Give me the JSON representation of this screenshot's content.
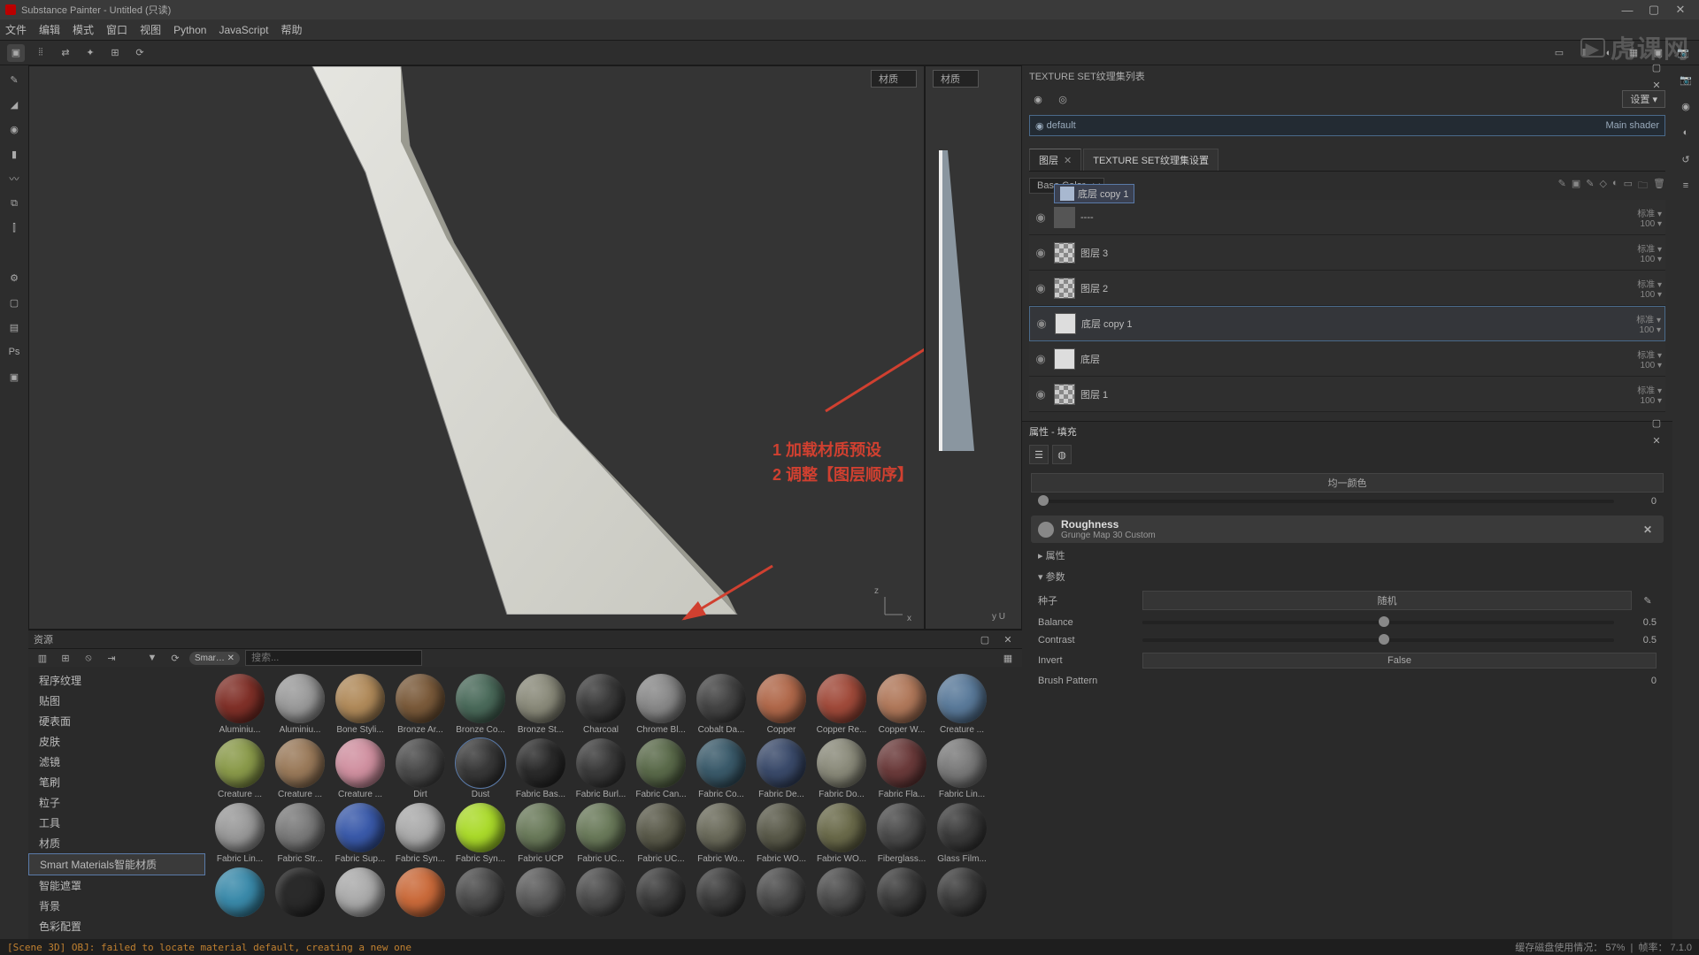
{
  "window": {
    "title": "Substance Painter - Untitled (只读)"
  },
  "menubar": [
    "文件",
    "编辑",
    "模式",
    "窗口",
    "视图",
    "Python",
    "JavaScript",
    "帮助"
  ],
  "viewport": {
    "dropdown3d": "材质",
    "dropdown2d": "材质",
    "annotation1": "1 加载材质预设",
    "annotation2": "2 调整【图层顺序】",
    "axis3d": {
      "x": "x",
      "z": "z"
    },
    "axis2d": {
      "u": "U",
      "y": "y"
    }
  },
  "right": {
    "texture_set_list_title": "TEXTURE SET纹理集列表",
    "settings_label": "设置",
    "shader_name": "default",
    "shader_type": "Main shader",
    "tab_layers": "图层",
    "tab_texset": "TEXTURE SET纹理集设置",
    "channel": "Base Color",
    "drag_ghost": "底层 copy 1",
    "layers": [
      {
        "name": "----",
        "thumb": "folder",
        "blend": "标准",
        "opacity": "100"
      },
      {
        "name": "图层 3",
        "thumb": "checker",
        "blend": "标准",
        "opacity": "100"
      },
      {
        "name": "图层 2",
        "thumb": "checker",
        "blend": "标准",
        "opacity": "100"
      },
      {
        "name": "底层 copy 1",
        "thumb": "solid",
        "blend": "标准",
        "opacity": "100",
        "selected": true
      },
      {
        "name": "底层",
        "thumb": "solid",
        "blend": "标准",
        "opacity": "100"
      },
      {
        "name": "图层 1",
        "thumb": "checker",
        "blend": "标准",
        "opacity": "100"
      }
    ],
    "props_title": "属性 - 填充",
    "fill_section": "均一颜色",
    "fill_value": "0",
    "roughness_title": "Roughness",
    "roughness_sub": "Grunge Map 30  Custom",
    "attrs_label": "属性",
    "params_label": "参数",
    "seed_label": "种子",
    "seed_btn": "随机",
    "balance_label": "Balance",
    "balance_val": "0.5",
    "contrast_label": "Contrast",
    "contrast_val": "0.5",
    "invert_label": "Invert",
    "invert_val": "False",
    "brush_label": "Brush Pattern",
    "brush_val": "0"
  },
  "assets": {
    "title": "资源",
    "search_placeholder": "搜索...",
    "filter_chip": "Smar…",
    "categories": [
      "程序纹理",
      "贴图",
      "硬表面",
      "皮肤",
      "滤镜",
      "笔刷",
      "粒子",
      "工具",
      "材质",
      "Smart Materials智能材质",
      "智能遮罩",
      "背景",
      "色彩配置"
    ],
    "selected_cat": "Smart Materials智能材质",
    "items": [
      {
        "label": "Aluminiu...",
        "c": "#803028"
      },
      {
        "label": "Aluminiu...",
        "c": "#9a9a9a"
      },
      {
        "label": "Bone Styli...",
        "c": "#b08a5a"
      },
      {
        "label": "Bronze Ar...",
        "c": "#7a5a3a"
      },
      {
        "label": "Bronze Co...",
        "c": "#4a6a5a"
      },
      {
        "label": "Bronze St...",
        "c": "#8a8a7a"
      },
      {
        "label": "Charcoal",
        "c": "#3a3a3a"
      },
      {
        "label": "Chrome Bl...",
        "c": "#888"
      },
      {
        "label": "Cobalt Da...",
        "c": "#444"
      },
      {
        "label": "Copper",
        "c": "#b0684a"
      },
      {
        "label": "Copper Re...",
        "c": "#a04a3a"
      },
      {
        "label": "Copper W...",
        "c": "#b0785a"
      },
      {
        "label": "Creature ...",
        "c": "#5a7a9a"
      },
      {
        "label": "Creature ...",
        "c": "#8a9a4a"
      },
      {
        "label": "Creature ...",
        "c": "#9a7a5a"
      },
      {
        "label": "Creature ...",
        "c": "#d090a0"
      },
      {
        "label": "Dirt",
        "c": "#4a4a4a"
      },
      {
        "label": "Dust",
        "c": "#383838",
        "active": true
      },
      {
        "label": "Fabric Bas...",
        "c": "#2a2a2a"
      },
      {
        "label": "Fabric Burl...",
        "c": "#3a3a3a"
      },
      {
        "label": "Fabric Can...",
        "c": "#5a6a4a"
      },
      {
        "label": "Fabric Co...",
        "c": "#3a5a6a"
      },
      {
        "label": "Fabric De...",
        "c": "#3a4a6a"
      },
      {
        "label": "Fabric Do...",
        "c": "#8a8a7a"
      },
      {
        "label": "Fabric Fla...",
        "c": "#6a3a3a"
      },
      {
        "label": "Fabric Lin...",
        "c": "#7a7a7a"
      },
      {
        "label": "Fabric Lin...",
        "c": "#999"
      },
      {
        "label": "Fabric Str...",
        "c": "#7a7a7a"
      },
      {
        "label": "Fabric Sup...",
        "c": "#3a5aaa"
      },
      {
        "label": "Fabric Syn...",
        "c": "#aaa"
      },
      {
        "label": "Fabric Syn...",
        "c": "#aada2a"
      },
      {
        "label": "Fabric UCP",
        "c": "#6a7a5a"
      },
      {
        "label": "Fabric UC...",
        "c": "#6a7a5a"
      },
      {
        "label": "Fabric UC...",
        "c": "#5a5a4a"
      },
      {
        "label": "Fabric Wo...",
        "c": "#6a6a5a"
      },
      {
        "label": "Fabric WO...",
        "c": "#5a5a4a"
      },
      {
        "label": "Fabric WO...",
        "c": "#6a6a4a"
      },
      {
        "label": "Fiberglass...",
        "c": "#4a4a4a"
      },
      {
        "label": "Glass Film...",
        "c": "#3a3a3a"
      },
      {
        "label": "",
        "c": "#3a8aaa"
      },
      {
        "label": "",
        "c": "#caa a3a"
      },
      {
        "label": "",
        "c": "#aaa"
      },
      {
        "label": "",
        "c": "#ca6a3a"
      },
      {
        "label": "",
        "c": "#4a4a4a"
      },
      {
        "label": "",
        "c": "#5a5a5a"
      },
      {
        "label": "",
        "c": "#4a4a4a"
      },
      {
        "label": "",
        "c": "#3a3a3a"
      },
      {
        "label": "",
        "c": "#3a3a3a"
      },
      {
        "label": "",
        "c": "#4a4a4a"
      },
      {
        "label": "",
        "c": "#4a4a4a"
      },
      {
        "label": "",
        "c": "#3a3a3a"
      },
      {
        "label": "",
        "c": "#3a3a3a"
      }
    ]
  },
  "statusbar": {
    "log": "[Scene 3D] OBJ: failed to locate material default, creating a new one",
    "disk": "缓存磁盘使用情况：",
    "disk_val": "57%",
    "fps_label": "帧率：",
    "fps_val": "7.1.0"
  },
  "watermark": "虎课网"
}
